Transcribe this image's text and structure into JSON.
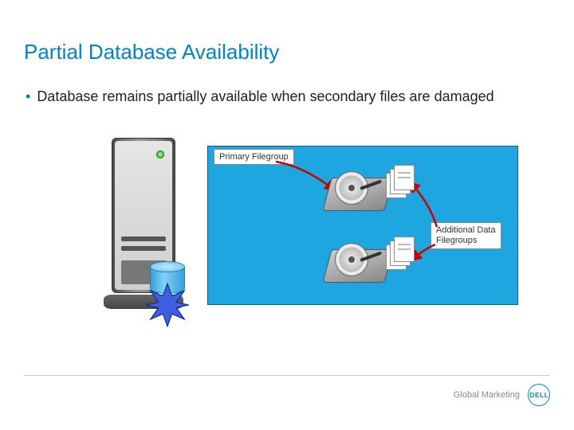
{
  "title": "Partial Database Availability",
  "bullet": "Database remains partially available when secondary files are damaged",
  "diagram": {
    "primary_label": "Primary Filegroup",
    "additional_label_line1": "Additional Data",
    "additional_label_line2": "Filegroups"
  },
  "footer": {
    "text": "Global Marketing",
    "logo": "DELL"
  }
}
